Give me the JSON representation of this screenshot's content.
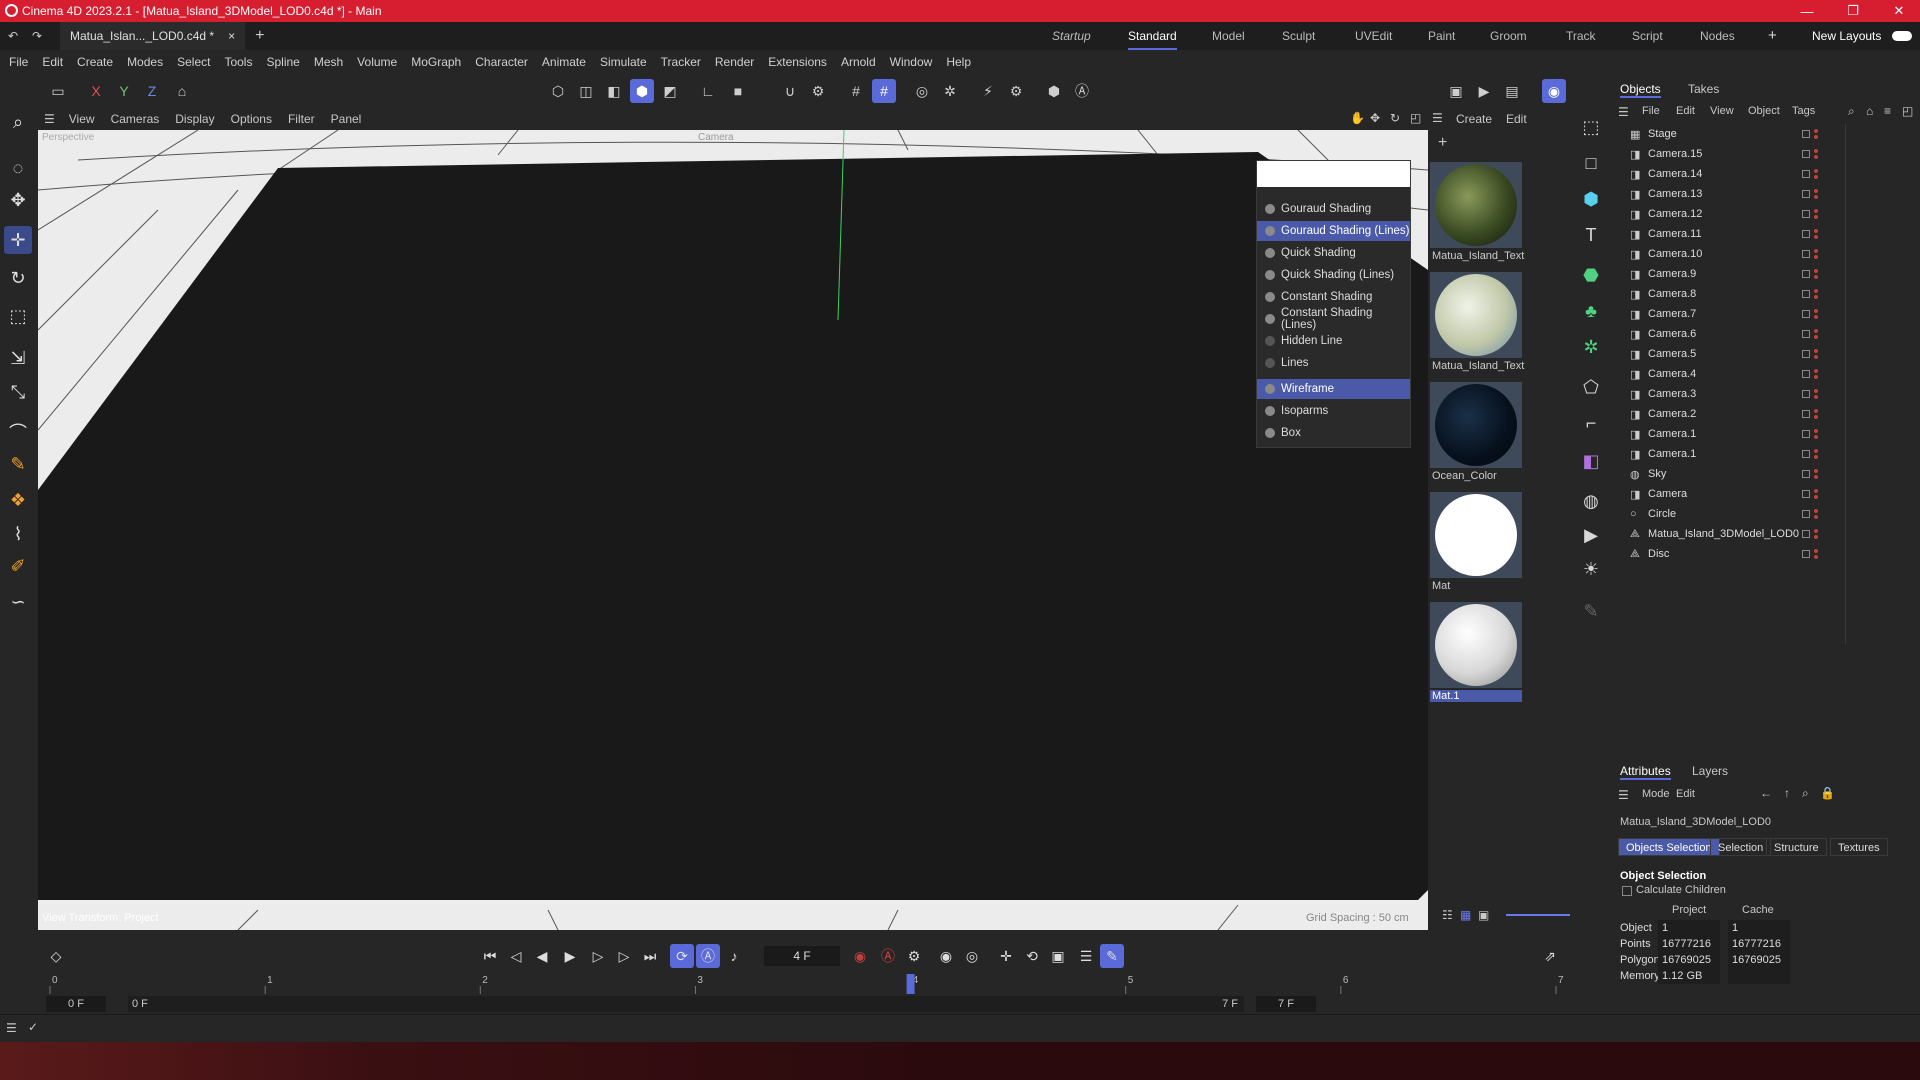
{
  "window": {
    "title": "Cinema 4D 2023.2.1 - [Matua_Island_3DModel_LOD0.c4d *] - Main"
  },
  "doc_tab": {
    "label": "Matua_Islan..._LOD0.c4d *",
    "close": "×"
  },
  "layouts": {
    "tabs": [
      "Startup",
      "Standard",
      "Model",
      "Sculpt",
      "UVEdit",
      "Paint",
      "Groom",
      "Track",
      "Script",
      "Nodes"
    ],
    "active": "Standard",
    "new_layouts": "New Layouts"
  },
  "menu": [
    "File",
    "Edit",
    "Create",
    "Modes",
    "Select",
    "Tools",
    "Spline",
    "Mesh",
    "Volume",
    "MoGraph",
    "Character",
    "Animate",
    "Simulate",
    "Tracker",
    "Render",
    "Extensions",
    "Arnold",
    "Window",
    "Help"
  ],
  "axes": {
    "x": "X",
    "y": "Y",
    "z": "Z"
  },
  "viewport": {
    "menu": [
      "View",
      "Cameras",
      "Display",
      "Options",
      "Filter",
      "Panel"
    ],
    "perspective_label": "Perspective",
    "camera_label": "Camera",
    "view_transform": "View Transform: Project",
    "grid_spacing": "Grid Spacing : 50 cm"
  },
  "shading_menu": {
    "items": [
      {
        "label": "Gouraud Shading",
        "highlighted": false
      },
      {
        "label": "Gouraud Shading (Lines)",
        "highlighted": true
      },
      {
        "label": "Quick Shading",
        "highlighted": false
      },
      {
        "label": "Quick Shading (Lines)",
        "highlighted": false
      },
      {
        "label": "Constant Shading",
        "highlighted": false
      },
      {
        "label": "Constant Shading (Lines)",
        "highlighted": false
      },
      {
        "label": "Hidden Line",
        "highlighted": false
      },
      {
        "label": "Lines",
        "highlighted": false
      },
      {
        "label": "Wireframe",
        "highlighted": true
      },
      {
        "label": "Isoparms",
        "highlighted": false
      },
      {
        "label": "Box",
        "highlighted": false
      }
    ]
  },
  "materials": {
    "menu": [
      "Create",
      "Edit"
    ],
    "items": [
      {
        "name": "Matua_Island_Text",
        "color": "#4a5a2e"
      },
      {
        "name": "Matua_Island_Text",
        "color": "#cfd6c0"
      },
      {
        "name": "Ocean_Color",
        "color": "#0b1a2a"
      },
      {
        "name": "Mat",
        "color": "#ffffff"
      },
      {
        "name": "Mat.1",
        "color": "#e8e8e8",
        "selected": true
      }
    ]
  },
  "objects_panel": {
    "tabs": [
      "Objects",
      "Takes"
    ],
    "menu": [
      "File",
      "Edit",
      "View",
      "Object",
      "Tags"
    ],
    "rows": [
      {
        "name": "Stage",
        "icon": "stage-icon"
      },
      {
        "name": "Camera.15",
        "icon": "camera-icon"
      },
      {
        "name": "Camera.14",
        "icon": "camera-icon"
      },
      {
        "name": "Camera.13",
        "icon": "camera-icon"
      },
      {
        "name": "Camera.12",
        "icon": "camera-icon"
      },
      {
        "name": "Camera.11",
        "icon": "camera-icon"
      },
      {
        "name": "Camera.10",
        "icon": "camera-icon"
      },
      {
        "name": "Camera.9",
        "icon": "camera-icon"
      },
      {
        "name": "Camera.8",
        "icon": "camera-icon"
      },
      {
        "name": "Camera.7",
        "icon": "camera-icon"
      },
      {
        "name": "Camera.6",
        "icon": "camera-icon"
      },
      {
        "name": "Camera.5",
        "icon": "camera-icon"
      },
      {
        "name": "Camera.4",
        "icon": "camera-icon"
      },
      {
        "name": "Camera.3",
        "icon": "camera-icon"
      },
      {
        "name": "Camera.2",
        "icon": "camera-icon"
      },
      {
        "name": "Camera.1",
        "icon": "camera-icon"
      },
      {
        "name": "Camera.1",
        "icon": "camera-icon"
      },
      {
        "name": "Sky",
        "icon": "sky-icon"
      },
      {
        "name": "Camera",
        "icon": "camera-icon"
      },
      {
        "name": "Circle",
        "icon": "circle-icon"
      },
      {
        "name": "Matua_Island_3DModel_LOD0",
        "icon": "polygon-icon"
      },
      {
        "name": "Disc",
        "icon": "polygon-icon"
      }
    ]
  },
  "attributes": {
    "tabs": [
      "Attributes",
      "Layers"
    ],
    "menu": [
      "Mode",
      "Edit"
    ],
    "object_name": "Matua_Island_3DModel_LOD0",
    "subtabs": [
      "Objects Selection",
      "Selection",
      "Structure",
      "Textures"
    ],
    "section": "Object Selection",
    "calc_children": "Calculate Children",
    "col_project": "Project",
    "col_cache": "Cache",
    "rows": [
      {
        "label": "Object",
        "project": "1",
        "cache": "1"
      },
      {
        "label": "Points",
        "project": "16777216",
        "cache": "16777216"
      },
      {
        "label": "Polygons",
        "project": "16769025",
        "cache": "16769025"
      },
      {
        "label": "Memory",
        "project": "1.12 GB",
        "cache": ""
      }
    ]
  },
  "timeline": {
    "current_frame": "4 F",
    "ticks": [
      "0",
      "1",
      "2",
      "3",
      "4",
      "5",
      "6",
      "7"
    ],
    "current_tick": 4,
    "start": "0 F",
    "start2": "0 F",
    "end": "7 F",
    "end2": "7 F"
  },
  "colors": {
    "accent": "#5a6ad8",
    "titlebar": "#d71e30",
    "panel": "#262626"
  }
}
